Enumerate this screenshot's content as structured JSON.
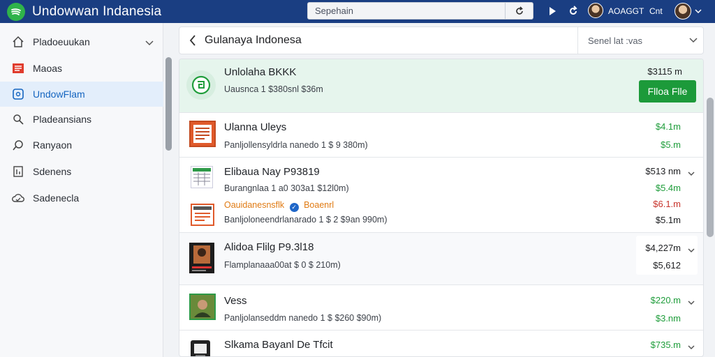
{
  "app": {
    "title": "Undowwan Indanesia"
  },
  "search": {
    "placeholder": "Sepehain"
  },
  "topbar": {
    "user_name": "AOAGGT",
    "user_short": "Cnt"
  },
  "sidebar": {
    "items": [
      {
        "label": "Pladoeuukan",
        "icon": "home-icon",
        "has_chevron": true,
        "active": false
      },
      {
        "label": "Maoas",
        "icon": "list-icon",
        "active": false
      },
      {
        "label": "UndowFlam",
        "icon": "square-icon",
        "active": true
      },
      {
        "label": "Pladeansians",
        "icon": "search-icon",
        "active": false
      },
      {
        "label": "Ranyaon",
        "icon": "chat-icon",
        "active": false
      },
      {
        "label": "Sdenens",
        "icon": "calendar-icon",
        "active": false
      },
      {
        "label": "Sadenecla",
        "icon": "cloud-icon",
        "active": false
      }
    ]
  },
  "header": {
    "title": "Gulanaya Indonesa",
    "sort_label": "Senel lat :vas"
  },
  "rows": [
    {
      "title": "Unlolaha BKKK",
      "subtitle": "Uausnca 1 $380snl $36m",
      "amount": "$3115 m",
      "button": "Flloa Flle"
    },
    {
      "title": "Ulanna Uleys",
      "subtitle": "Panljollensyldrla nanedo 1 $ 9 380m)",
      "amount1": "$4.1m",
      "amount2": "$5.m"
    },
    {
      "title": "Elibaua Nay P93819",
      "subtitle": "Burangnlaa 1 a0 303a1 $12l0m)",
      "amount1": "$513 nm",
      "amount2": "$5.4m",
      "amount3": "$6.1.m",
      "amount4": "$5.1m",
      "tag_text": "Oauidanesnsflk",
      "tag_text2": "Boaenrl",
      "subtitle2": "Banljoloneendrlanarado 1 $ 2 $9an 990m)"
    },
    {
      "title": "Alidoa Flilg P9.3l18",
      "subtitle": "Flamplanaaa00at $ 0 $ 210m)",
      "amount1": "$4,227m",
      "amount2": "$5,612"
    },
    {
      "title": "Vess",
      "subtitle": "Panljolanseddm nanedo 1 $ $260 $90m)",
      "amount1": "$220.m",
      "amount2": "$3.nm"
    },
    {
      "title": "Slkama Bayanl De Tfcit",
      "amount1": "$735.m"
    }
  ],
  "colors": {
    "topbar": "#1a3e82",
    "accent_green": "#1f9d3b",
    "highlight": "#e6f5ed"
  }
}
